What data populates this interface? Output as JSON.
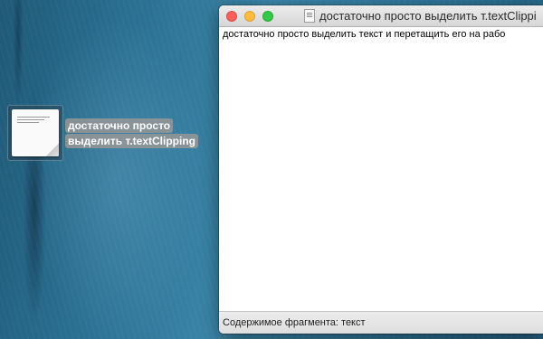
{
  "desktop": {
    "clipping_file": {
      "icon": "text-clipping-icon",
      "label_line1": "достаточно просто",
      "label_line2": "выделить т.textClipping"
    }
  },
  "window": {
    "title": "достаточно просто выделить т.textClippi",
    "title_icon": "text-clipping-document-icon",
    "controls": [
      "close",
      "minimize",
      "zoom"
    ],
    "content_text": "достаточно просто выделить текст и перетащить его на рабо",
    "status_text": "Содержимое фрагмента: текст"
  },
  "colors": {
    "close": "#fc605c",
    "minimize": "#fdbc40",
    "zoom": "#34c84a",
    "label_highlight": "#969696"
  }
}
